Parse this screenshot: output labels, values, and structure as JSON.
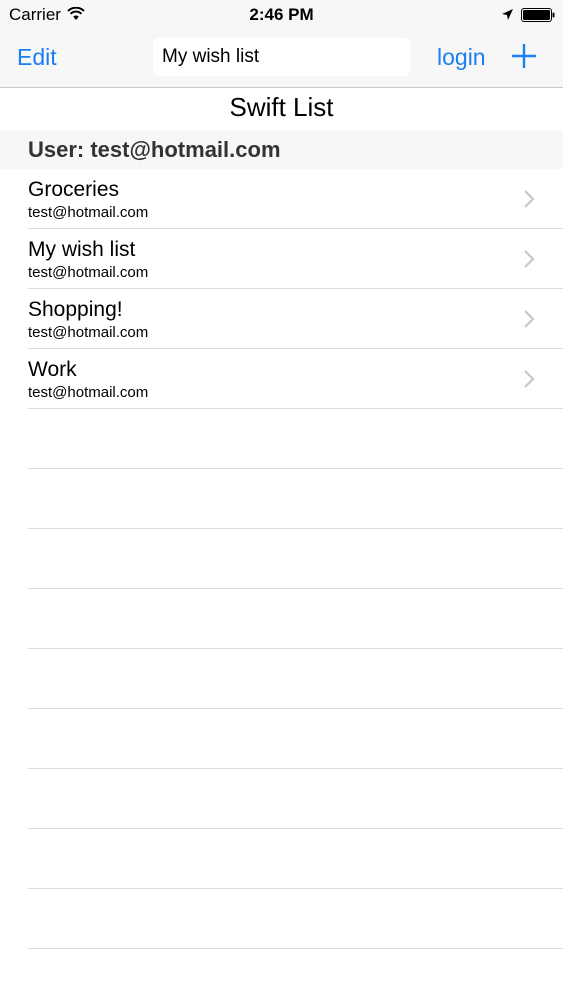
{
  "status_bar": {
    "carrier": "Carrier",
    "time": "2:46 PM",
    "icons": [
      "wifi-icon",
      "location-icon",
      "battery-icon"
    ]
  },
  "nav_bar": {
    "edit_label": "Edit",
    "list_name_input_value": "My wish list",
    "login_label": "login",
    "add_icon": "plus-icon"
  },
  "page": {
    "title": "Swift List"
  },
  "section": {
    "header": "User: test@hotmail.com"
  },
  "lists": [
    {
      "title": "Groceries",
      "owner": "test@hotmail.com"
    },
    {
      "title": "My wish list",
      "owner": "test@hotmail.com"
    },
    {
      "title": "Shopping!",
      "owner": "test@hotmail.com"
    },
    {
      "title": "Work",
      "owner": "test@hotmail.com"
    }
  ],
  "colors": {
    "tint": "#1a7ff2",
    "bar_background": "#f7f7f7",
    "separator": "#dcdce0",
    "chevron": "#c7c7cc"
  }
}
